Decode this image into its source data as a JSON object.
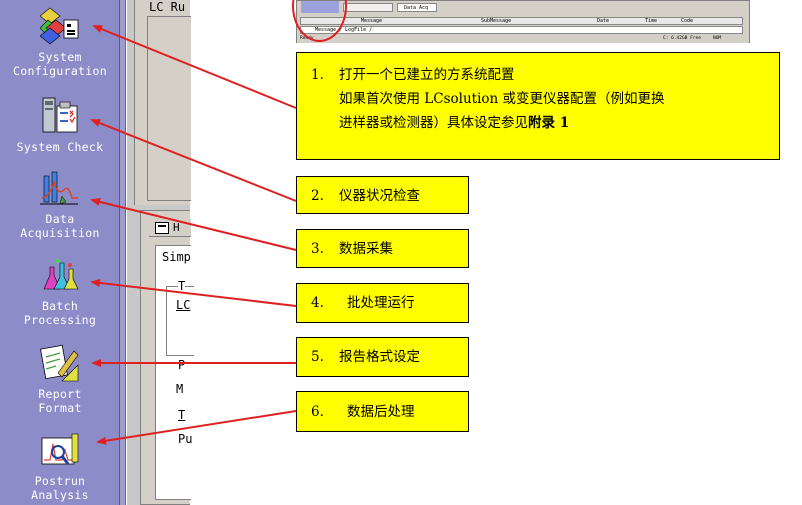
{
  "nav": {
    "items": [
      {
        "id": "system-configuration",
        "lines": [
          "System",
          "Configuration"
        ]
      },
      {
        "id": "system-check",
        "lines": [
          "System Check"
        ]
      },
      {
        "id": "data-acquisition",
        "lines": [
          "Data",
          "Acquisition"
        ]
      },
      {
        "id": "batch-processing",
        "lines": [
          "Batch",
          "Processing"
        ]
      },
      {
        "id": "report-format",
        "lines": [
          "Report",
          "Format"
        ]
      },
      {
        "id": "postrun-analysis",
        "lines": [
          "Postrun",
          "Analysis"
        ]
      }
    ]
  },
  "background_window": {
    "title_fragment": "LC Ru",
    "tab_fragment": "H",
    "tab_text": "Simp",
    "group1_label": "T",
    "group1_text": "LC",
    "field_labels": [
      "P",
      "M",
      "T",
      "Pu"
    ]
  },
  "thumbnail": {
    "tab_label": "Data Acq",
    "columns": [
      "Message",
      "SubMessage",
      "Date",
      "Time",
      "Code"
    ],
    "log_tabs": "Message / LogFile /",
    "status_left": "Ready",
    "status_disk": "C: 6.42GB Free",
    "status_mode": "NUM"
  },
  "callouts": [
    {
      "num": "1.",
      "lines": [
        "打开一个已建立的方系统配置",
        "如果首次使用 LCsolution 或变更仪器配置（例如更换",
        "进样器或检测器）具体设定参见"
      ],
      "bold_suffix": "附录 1"
    },
    {
      "num": "2.",
      "text": "仪器状况检查"
    },
    {
      "num": "3.",
      "text": "数据采集"
    },
    {
      "num": "4.",
      "text": "批处理运行"
    },
    {
      "num": "5.",
      "text": "报告格式设定"
    },
    {
      "num": "6.",
      "text": "数据后处理"
    }
  ],
  "colors": {
    "nav_background": "#8c8cc8",
    "callout_background": "#ffff00",
    "arrow": "#e02020"
  }
}
